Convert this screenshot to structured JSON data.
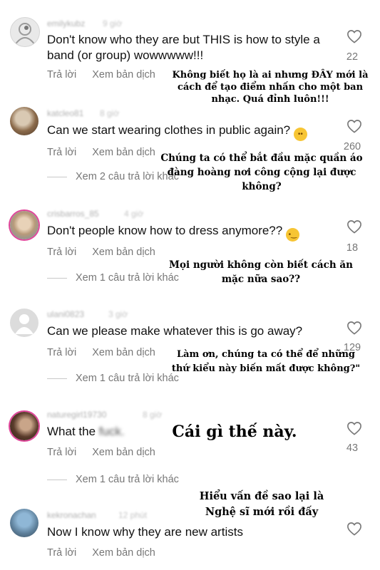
{
  "actions": {
    "reply": "Trả lời",
    "see_translation": "Xem bản dịch"
  },
  "comments": [
    {
      "username": "emilykubz",
      "time": "9 giờ",
      "text": "Don't know who they are but THIS is how to style a band (or group) wowwwww!!!",
      "likes": "22",
      "translation": "Không biết họ là ai nhưng ĐÂY mới là cách để tạo điểm nhấn cho một ban nhạc. Quá đỉnh luôn!!!"
    },
    {
      "username": "katcleo81",
      "time": "8 giờ",
      "text": "Can we start wearing clothes in public again?",
      "emoji": "rolling-eyes-emoji",
      "likes": "260",
      "view_replies": "Xem 2 câu trả lời khác",
      "translation": "Chúng ta có thể bắt đầu mặc quần áo đàng hoàng nơi công cộng lại được không?"
    },
    {
      "username": "crisbarros_85",
      "time": "4 giờ",
      "text": "Don't people know how to dress anymore??",
      "emoji": "raised-eyebrow-emoji",
      "likes": "18",
      "view_replies": "Xem 1 câu trả lời khác",
      "translation": "Mọi người không còn biết cách ăn mặc nữa sao??"
    },
    {
      "username": "ulani0823",
      "time": "3 giờ",
      "text": "Can we please make whatever this is go away?",
      "likes": "129",
      "view_replies": "Xem 1 câu trả lời khác",
      "translation": "Làm ơn, chúng ta có thể để những thứ kiểu này biến mất được không?\""
    },
    {
      "username": "naturegirl19730",
      "time": "8 giờ",
      "text_prefix": "What the",
      "text_blurred": "fuck.",
      "likes": "43",
      "view_replies": "Xem 1 câu trả lời khác",
      "translation": "Cái gì thế này."
    },
    {
      "username": "kekronachan",
      "time": "12 phút",
      "text": "Now I know why they are new artists",
      "translation": "Hiểu vấn đề sao lại là Nghệ sĩ mới rồi đấy"
    }
  ]
}
